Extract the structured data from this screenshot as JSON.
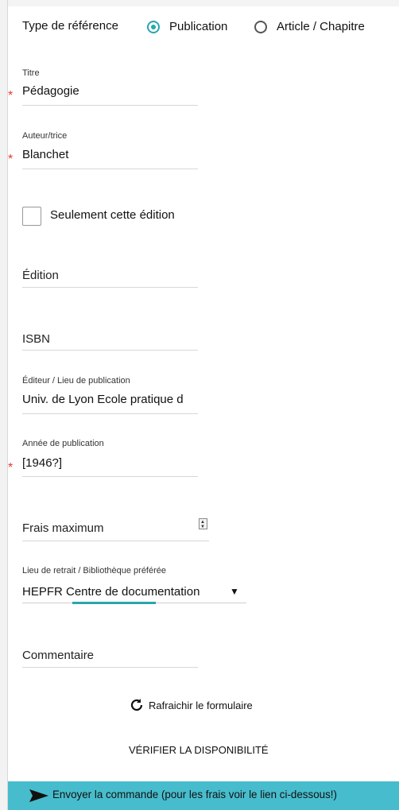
{
  "reference_type": {
    "label": "Type de référence",
    "options": [
      "Publication",
      "Article / Chapitre"
    ],
    "selected": "Publication"
  },
  "fields": {
    "titre": {
      "label": "Titre",
      "value": "Pédagogie",
      "required": true
    },
    "auteur": {
      "label": "Auteur/trice",
      "value": "Blanchet",
      "required": true
    },
    "seulement_edition": {
      "label": "Seulement cette édition",
      "checked": false
    },
    "edition": {
      "label": "Édition",
      "value": ""
    },
    "isbn": {
      "label": "ISBN",
      "value": ""
    },
    "editeur": {
      "label": "Éditeur / Lieu de publication",
      "value": "Univ. de Lyon Ecole pratique d"
    },
    "annee": {
      "label": "Année de publication",
      "value": "[1946?]",
      "required": true
    },
    "frais": {
      "label": "Frais maximum",
      "value": ""
    },
    "lieu_retrait": {
      "label": "Lieu de retrait / Bibliothèque préférée",
      "selected": "HEPFR Centre de documentation"
    },
    "commentaire": {
      "label": "Commentaire",
      "value": ""
    }
  },
  "actions": {
    "refresh": "Rafraichir le formulaire",
    "verify": "VÉRIFIER LA DISPONIBILITÉ",
    "send": "Envoyer la commande (pour les frais voir le lien ci-dessous!)"
  },
  "colors": {
    "accent": "#2aa6ad",
    "send_bar": "#47bccc",
    "required": "#e53935"
  },
  "icons": {
    "radio_selected": "radio-selected-icon",
    "radio_unselected": "radio-unselected-icon",
    "refresh": "refresh-icon",
    "send": "send-arrow-icon",
    "dropdown": "dropdown-triangle-icon",
    "spinner": "number-spinner-icon"
  },
  "required_marker": "*"
}
